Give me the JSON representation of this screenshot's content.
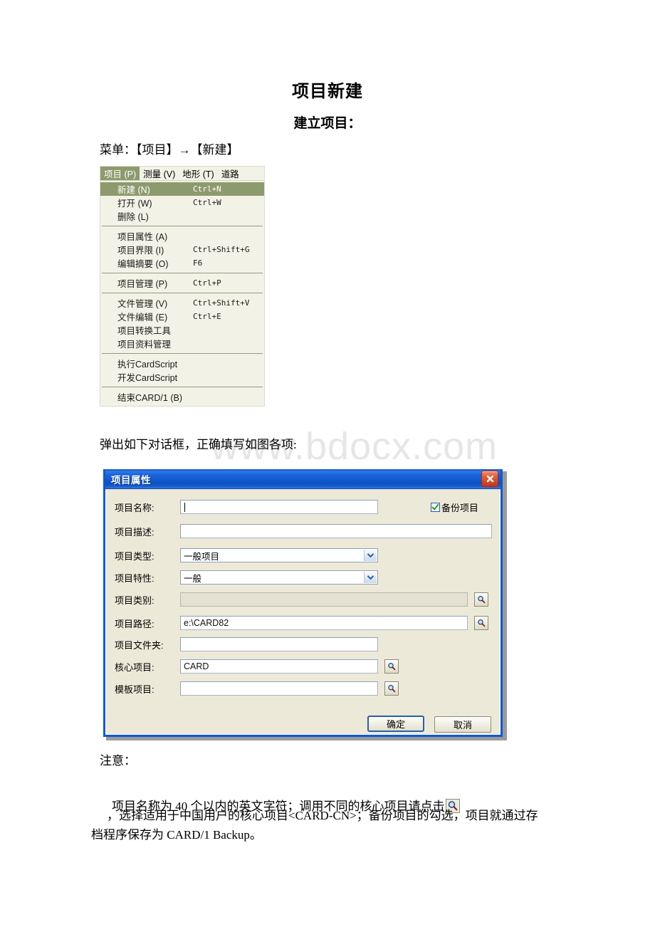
{
  "document": {
    "title": "项目新建",
    "subtitle": "建立项目：",
    "menu_path_text": "菜单：【项目】→【新建】",
    "dialog_lead_text": "弹出如下对话框，正确填写如图各项:",
    "note_title": "注意：",
    "note_line1": "项目名称为 40 个以内的英文字符；调用不同的核心项目请点击",
    "note_line2": "，选择适用于中国用户的核心项目<CARD-CN>；备份项目的勾选，项目就通过存",
    "note_line3": "档程序保存为 CARD/1 Backup。",
    "watermark": "www.bdocx.com"
  },
  "menu_widget": {
    "menubar": [
      {
        "label": "项目 (P)",
        "active": true
      },
      {
        "label": "测量 (V)",
        "active": false
      },
      {
        "label": "地形 (T)",
        "active": false
      },
      {
        "label": "道路",
        "active": false
      }
    ],
    "groups": [
      {
        "items": [
          {
            "label": "新建 (N)",
            "accel": "Ctrl+N",
            "highlight": true
          },
          {
            "label": "打开 (W)",
            "accel": "Ctrl+W",
            "highlight": false
          },
          {
            "label": "删除 (L)",
            "accel": "",
            "highlight": false
          }
        ]
      },
      {
        "items": [
          {
            "label": "项目属性 (A)",
            "accel": "",
            "highlight": false
          },
          {
            "label": "项目界限 (I)",
            "accel": "Ctrl+Shift+G",
            "highlight": false
          },
          {
            "label": "编辑摘要 (O)",
            "accel": "F6",
            "highlight": false
          }
        ]
      },
      {
        "items": [
          {
            "label": "项目管理 (P)",
            "accel": "Ctrl+P",
            "highlight": false
          }
        ]
      },
      {
        "items": [
          {
            "label": "文件管理 (V)",
            "accel": "Ctrl+Shift+V",
            "highlight": false
          },
          {
            "label": "文件编辑 (E)",
            "accel": "Ctrl+E",
            "highlight": false
          },
          {
            "label": "项目转换工具",
            "accel": "",
            "highlight": false
          },
          {
            "label": "项目资料管理",
            "accel": "",
            "highlight": false
          }
        ]
      },
      {
        "items": [
          {
            "label": "执行CardScript",
            "accel": "",
            "highlight": false
          },
          {
            "label": "开发CardScript",
            "accel": "",
            "highlight": false
          }
        ]
      },
      {
        "items": [
          {
            "label": "结束CARD/1 (B)",
            "accel": "",
            "highlight": false
          }
        ]
      }
    ],
    "colors": {
      "highlight": "#8d9a6e",
      "background": "#f2f2e6"
    }
  },
  "dialog": {
    "title": "项目属性",
    "close_icon": "close-icon",
    "titlebar_color": "#1a64da",
    "fields": {
      "project_name": {
        "label": "项目名称:",
        "value": ""
      },
      "project_desc": {
        "label": "项目描述:",
        "value": ""
      },
      "project_type": {
        "label": "项目类型:",
        "value": "一般项目"
      },
      "project_feature": {
        "label": "项目特性:",
        "value": "一般"
      },
      "project_category": {
        "label": "项目类别:",
        "value": ""
      },
      "project_path": {
        "label": "项目路径:",
        "value": "e:\\CARD82"
      },
      "project_folder": {
        "label": "项目文件夹:",
        "value": ""
      },
      "core_project": {
        "label": "核心项目:",
        "value": "CARD"
      },
      "template_project": {
        "label": "模板项目:",
        "value": ""
      }
    },
    "checkbox": {
      "label": "备份项目",
      "checked": true
    },
    "buttons": {
      "ok": "确定",
      "cancel": "取消"
    }
  }
}
